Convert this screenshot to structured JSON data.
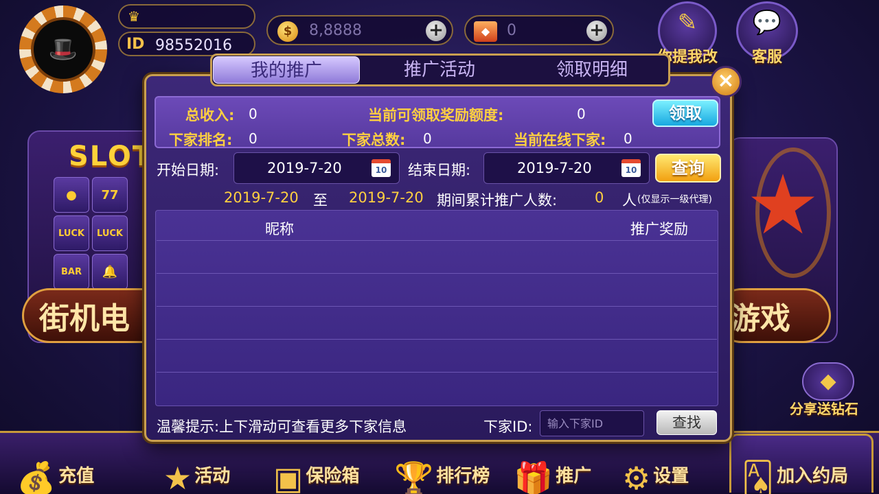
{
  "top_bar": {
    "id_label": "ID",
    "player_id": "98552016",
    "coins": "8,8888",
    "diamonds": "0",
    "feedback_label": "你提我改",
    "service_label": "客服"
  },
  "background": {
    "slot_title": "SLOT",
    "left_banner": "街机电",
    "right_banner": "游戏",
    "slot_cells": [
      "77",
      "LUCK",
      "LUCK",
      "BAR",
      "🔔",
      "●"
    ]
  },
  "dialog": {
    "tabs": [
      "我的推广",
      "推广活动",
      "领取明细"
    ],
    "active_tab": 0,
    "close_label": "×",
    "stats": {
      "total_income_label": "总收入:",
      "total_income_value": "0",
      "claimable_label": "当前可领取奖励额度:",
      "claimable_value": "0",
      "sub_rank_label": "下家排名:",
      "sub_rank_value": "0",
      "sub_total_label": "下家总数:",
      "sub_total_value": "0",
      "sub_online_label": "当前在线下家:",
      "sub_online_value": "0"
    },
    "claim_button": "领取",
    "start_date_label": "开始日期:",
    "start_date": "2019-7-20",
    "end_date_label": "结束日期:",
    "end_date": "2019-7-20",
    "query_button": "查询",
    "range": {
      "from": "2019-7-20",
      "to_word": "至",
      "to": "2019-7-20",
      "count_label": "期间累计推广人数:",
      "count_value": "0",
      "unit": "人",
      "note": "(仅显示一级代理)"
    },
    "table": {
      "columns": [
        "昵称",
        "推广奖励"
      ],
      "rows": []
    },
    "tip": "温馨提示:上下滑动可查看更多下家信息",
    "sub_id_label": "下家ID:",
    "sub_id_placeholder": "输入下家ID",
    "search_button": "查找"
  },
  "bottom_nav": [
    {
      "label": "充值",
      "icon": "money-bag-icon"
    },
    {
      "label": "活动",
      "icon": "star-icon"
    },
    {
      "label": "保险箱",
      "icon": "safe-icon"
    },
    {
      "label": "排行榜",
      "icon": "trophy-icon"
    },
    {
      "label": "推广",
      "icon": "gift-icon"
    },
    {
      "label": "设置",
      "icon": "gear-icon"
    },
    {
      "label": "加入约局",
      "icon": "cards-icon"
    }
  ],
  "share_label": "分享送钻石",
  "colors": {
    "accent_gold": "#ffd040",
    "panel_purple": "#3d2878",
    "claim_blue": "#18a8e0",
    "query_orange": "#f2a010"
  }
}
